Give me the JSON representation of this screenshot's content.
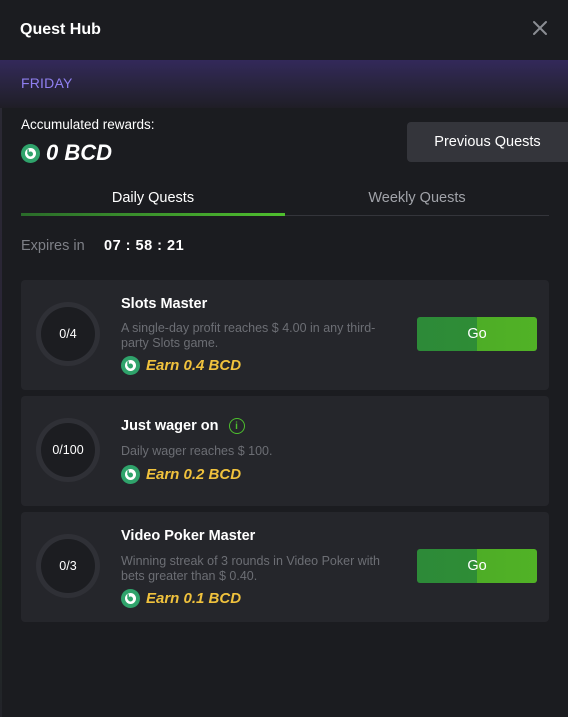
{
  "header": {
    "title": "Quest Hub",
    "close_icon": "close-icon"
  },
  "day": "FRIDAY",
  "rewards": {
    "label": "Accumulated rewards:",
    "amount": "0 BCD",
    "coin_icon": "bcd-coin-icon"
  },
  "previous_quests_label": "Previous Quests",
  "tabs": [
    {
      "label": "Daily Quests",
      "active": true
    },
    {
      "label": "Weekly Quests",
      "active": false
    }
  ],
  "expires": {
    "label": "Expires in",
    "time": "07 : 58 : 21"
  },
  "quests": [
    {
      "progress": "0/4",
      "title": "Slots Master",
      "description": "A single-day profit reaches $ 4.00 in any third-party Slots game.",
      "reward": "Earn 0.4 BCD",
      "button": "Go"
    },
    {
      "progress": "0/100",
      "title": "Just wager on",
      "description": "Daily wager reaches $ 100.",
      "reward": "Earn 0.2 BCD",
      "info_icon": "info-icon"
    },
    {
      "progress": "0/3",
      "title": "Video Poker Master",
      "description": "Winning streak of 3 rounds in Video Poker with bets greater than $ 0.40.",
      "reward": "Earn 0.1 BCD",
      "button": "Go"
    }
  ],
  "colors": {
    "background": "#1b1c20",
    "card": "#25262b",
    "accent_green": "#4dbf2d",
    "reward_gold": "#f0c23d",
    "day_purple": "#8f7ff0"
  }
}
